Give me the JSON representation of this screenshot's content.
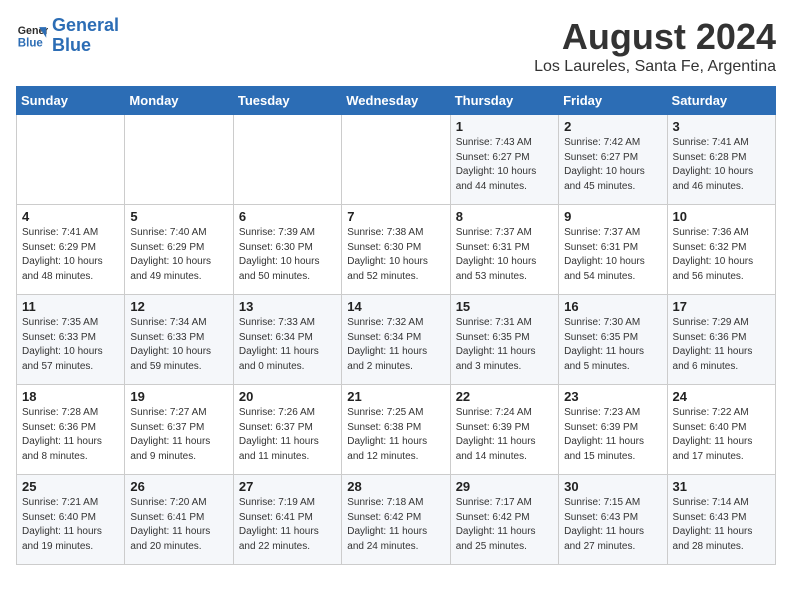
{
  "header": {
    "logo_line1": "General",
    "logo_line2": "Blue",
    "title": "August 2024",
    "subtitle": "Los Laureles, Santa Fe, Argentina"
  },
  "days_of_week": [
    "Sunday",
    "Monday",
    "Tuesday",
    "Wednesday",
    "Thursday",
    "Friday",
    "Saturday"
  ],
  "weeks": [
    [
      {
        "day": "",
        "info": ""
      },
      {
        "day": "",
        "info": ""
      },
      {
        "day": "",
        "info": ""
      },
      {
        "day": "",
        "info": ""
      },
      {
        "day": "1",
        "info": "Sunrise: 7:43 AM\nSunset: 6:27 PM\nDaylight: 10 hours\nand 44 minutes."
      },
      {
        "day": "2",
        "info": "Sunrise: 7:42 AM\nSunset: 6:27 PM\nDaylight: 10 hours\nand 45 minutes."
      },
      {
        "day": "3",
        "info": "Sunrise: 7:41 AM\nSunset: 6:28 PM\nDaylight: 10 hours\nand 46 minutes."
      }
    ],
    [
      {
        "day": "4",
        "info": "Sunrise: 7:41 AM\nSunset: 6:29 PM\nDaylight: 10 hours\nand 48 minutes."
      },
      {
        "day": "5",
        "info": "Sunrise: 7:40 AM\nSunset: 6:29 PM\nDaylight: 10 hours\nand 49 minutes."
      },
      {
        "day": "6",
        "info": "Sunrise: 7:39 AM\nSunset: 6:30 PM\nDaylight: 10 hours\nand 50 minutes."
      },
      {
        "day": "7",
        "info": "Sunrise: 7:38 AM\nSunset: 6:30 PM\nDaylight: 10 hours\nand 52 minutes."
      },
      {
        "day": "8",
        "info": "Sunrise: 7:37 AM\nSunset: 6:31 PM\nDaylight: 10 hours\nand 53 minutes."
      },
      {
        "day": "9",
        "info": "Sunrise: 7:37 AM\nSunset: 6:31 PM\nDaylight: 10 hours\nand 54 minutes."
      },
      {
        "day": "10",
        "info": "Sunrise: 7:36 AM\nSunset: 6:32 PM\nDaylight: 10 hours\nand 56 minutes."
      }
    ],
    [
      {
        "day": "11",
        "info": "Sunrise: 7:35 AM\nSunset: 6:33 PM\nDaylight: 10 hours\nand 57 minutes."
      },
      {
        "day": "12",
        "info": "Sunrise: 7:34 AM\nSunset: 6:33 PM\nDaylight: 10 hours\nand 59 minutes."
      },
      {
        "day": "13",
        "info": "Sunrise: 7:33 AM\nSunset: 6:34 PM\nDaylight: 11 hours\nand 0 minutes."
      },
      {
        "day": "14",
        "info": "Sunrise: 7:32 AM\nSunset: 6:34 PM\nDaylight: 11 hours\nand 2 minutes."
      },
      {
        "day": "15",
        "info": "Sunrise: 7:31 AM\nSunset: 6:35 PM\nDaylight: 11 hours\nand 3 minutes."
      },
      {
        "day": "16",
        "info": "Sunrise: 7:30 AM\nSunset: 6:35 PM\nDaylight: 11 hours\nand 5 minutes."
      },
      {
        "day": "17",
        "info": "Sunrise: 7:29 AM\nSunset: 6:36 PM\nDaylight: 11 hours\nand 6 minutes."
      }
    ],
    [
      {
        "day": "18",
        "info": "Sunrise: 7:28 AM\nSunset: 6:36 PM\nDaylight: 11 hours\nand 8 minutes."
      },
      {
        "day": "19",
        "info": "Sunrise: 7:27 AM\nSunset: 6:37 PM\nDaylight: 11 hours\nand 9 minutes."
      },
      {
        "day": "20",
        "info": "Sunrise: 7:26 AM\nSunset: 6:37 PM\nDaylight: 11 hours\nand 11 minutes."
      },
      {
        "day": "21",
        "info": "Sunrise: 7:25 AM\nSunset: 6:38 PM\nDaylight: 11 hours\nand 12 minutes."
      },
      {
        "day": "22",
        "info": "Sunrise: 7:24 AM\nSunset: 6:39 PM\nDaylight: 11 hours\nand 14 minutes."
      },
      {
        "day": "23",
        "info": "Sunrise: 7:23 AM\nSunset: 6:39 PM\nDaylight: 11 hours\nand 15 minutes."
      },
      {
        "day": "24",
        "info": "Sunrise: 7:22 AM\nSunset: 6:40 PM\nDaylight: 11 hours\nand 17 minutes."
      }
    ],
    [
      {
        "day": "25",
        "info": "Sunrise: 7:21 AM\nSunset: 6:40 PM\nDaylight: 11 hours\nand 19 minutes."
      },
      {
        "day": "26",
        "info": "Sunrise: 7:20 AM\nSunset: 6:41 PM\nDaylight: 11 hours\nand 20 minutes."
      },
      {
        "day": "27",
        "info": "Sunrise: 7:19 AM\nSunset: 6:41 PM\nDaylight: 11 hours\nand 22 minutes."
      },
      {
        "day": "28",
        "info": "Sunrise: 7:18 AM\nSunset: 6:42 PM\nDaylight: 11 hours\nand 24 minutes."
      },
      {
        "day": "29",
        "info": "Sunrise: 7:17 AM\nSunset: 6:42 PM\nDaylight: 11 hours\nand 25 minutes."
      },
      {
        "day": "30",
        "info": "Sunrise: 7:15 AM\nSunset: 6:43 PM\nDaylight: 11 hours\nand 27 minutes."
      },
      {
        "day": "31",
        "info": "Sunrise: 7:14 AM\nSunset: 6:43 PM\nDaylight: 11 hours\nand 28 minutes."
      }
    ]
  ]
}
